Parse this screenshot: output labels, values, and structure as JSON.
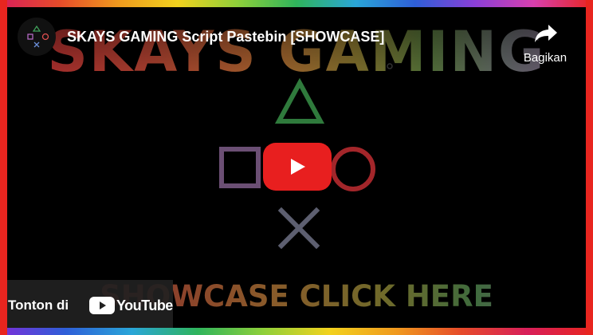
{
  "video": {
    "title": "SKAYS GAMING Script Pastebin [SHOWCASE]",
    "thumbnail_headline": "SKAYS GAMING",
    "thumbnail_footer": "SHOWCASE CLICK HERE"
  },
  "share": {
    "label": "Bagikan",
    "icon": "share-arrow-icon"
  },
  "watch_on": {
    "label": "Tonton di",
    "brand": "YouTube",
    "icon": "youtube-logo-icon"
  },
  "play": {
    "icon": "play-icon",
    "color": "#e81f1f"
  },
  "colors": {
    "border_side": "#e8251f",
    "triangle": "#2f7a3c",
    "square": "#6b4f74",
    "circle": "#a3262a",
    "cross": "#5d5f70"
  }
}
